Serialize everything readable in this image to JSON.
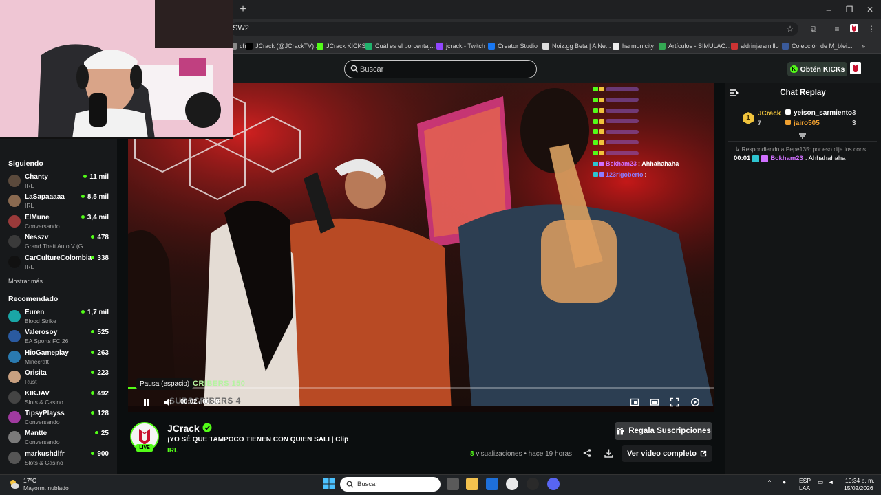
{
  "browser": {
    "url": "SW2",
    "bookmarks": [
      {
        "label": "ch",
        "color": "#888"
      },
      {
        "label": "JCrack (@JCrackTV)...",
        "color": "#000000"
      },
      {
        "label": "JCrack KICKS",
        "color": "#53fc18"
      },
      {
        "label": "Cuál es el porcentaj...",
        "color": "#20b26c"
      },
      {
        "label": "jcrack - Twitch",
        "color": "#9146ff"
      },
      {
        "label": "Creator Studio",
        "color": "#1877f2"
      },
      {
        "label": "Noiz.gg Beta | A Ne...",
        "color": "#dddddd"
      },
      {
        "label": "harmonicity",
        "color": "#eeeeee"
      },
      {
        "label": "Artículos - SIMULAC...",
        "color": "#34a853"
      },
      {
        "label": "aldrinjaramillo",
        "color": "#cc3333"
      },
      {
        "label": "Colección de M_blei...",
        "color": "#3a5a9a"
      }
    ],
    "more_label": "»"
  },
  "header": {
    "search_placeholder": "Buscar",
    "kicks_label": "Obtén KICKs"
  },
  "sidebar": {
    "following_heading": "Siguiendo",
    "following": [
      {
        "name": "Chanty",
        "category": "IRL",
        "viewers": "11 mil",
        "color": "#5b4a3c"
      },
      {
        "name": "LaSapaaaaa",
        "category": "IRL",
        "viewers": "8,5 mil",
        "color": "#8a6a50"
      },
      {
        "name": "ElMune",
        "category": "Conversando",
        "viewers": "3,4 mil",
        "color": "#9a3a3a"
      },
      {
        "name": "Nesszv",
        "category": "Grand Theft Auto V (G...",
        "viewers": "478",
        "color": "#3a3a3a"
      },
      {
        "name": "CarCultureColombia",
        "category": "IRL",
        "viewers": "338",
        "color": "#111111"
      }
    ],
    "show_more": "Mostrar más",
    "recommended_heading": "Recomendado",
    "recommended": [
      {
        "name": "Euren",
        "category": "Blood Strike",
        "viewers": "1,7 mil",
        "color": "#1aa6a6"
      },
      {
        "name": "Valerosoy",
        "category": "EA Sports FC 26",
        "viewers": "525",
        "color": "#2a5aa0"
      },
      {
        "name": "HioGameplay",
        "category": "Minecraft",
        "viewers": "263",
        "color": "#2a7ab0"
      },
      {
        "name": "Orisita",
        "category": "Rust",
        "viewers": "223",
        "color": "#c8a080"
      },
      {
        "name": "KIKJAV",
        "category": "Slots & Casino",
        "viewers": "492",
        "color": "#444444"
      },
      {
        "name": "TipsyPlayss",
        "category": "Conversando",
        "viewers": "128",
        "color": "#a03aa0"
      },
      {
        "name": "Mantte",
        "category": "Conversando",
        "viewers": "25",
        "color": "#7a7a7a"
      },
      {
        "name": "markushdlfr",
        "category": "Slots & Casino",
        "viewers": "900",
        "color": "#555555"
      }
    ]
  },
  "player": {
    "overlay_chat": [
      {
        "user": "Bckham23",
        "text": ": Ahhahahaha",
        "color": "#d070ff"
      },
      {
        "user": "123rigoberto",
        "text": " :",
        "color": "#8c7cff"
      }
    ],
    "sub_overlay_1": "CRIBERS  150",
    "sub_overlay_2": "SUBSCRIBERS   4",
    "tooltip": "Pausa (espacio)",
    "time": "00:02 / 00:30",
    "progress": 0.07
  },
  "video_info": {
    "channel": "JCrack",
    "live_label": "LIVE",
    "title": "¡YO SÉ QUE TAMPOCO TIENEN CON QUIEN SALI | Clip",
    "category": "IRL",
    "gift_label": "Regala Suscripciones",
    "views_count": "8",
    "views_text": " visualizaciones • hace 19 horas",
    "full_video_label": "Ver video completo"
  },
  "chat": {
    "title": "Chat Replay",
    "leader": {
      "rank": "1",
      "name": "JCrack",
      "count": "7"
    },
    "leaders": [
      {
        "name": "yeison_sarmiento",
        "count": "3",
        "color": "#ffffff"
      },
      {
        "name": "jairo505",
        "count": "3",
        "color": "#f0a030"
      }
    ],
    "reply_to": "Respondiendo a Pepe135: por eso dije los cons...",
    "message": {
      "time": "00:01",
      "user": "Bckham23",
      "text": ": Ahhahahaha"
    }
  },
  "taskbar": {
    "temp": "17°C",
    "weather": "Mayorm. nublado",
    "search": "Buscar",
    "lang1": "ESP",
    "lang2": "LAA",
    "time": "10:34 p. m.",
    "date": "15/02/2026"
  }
}
